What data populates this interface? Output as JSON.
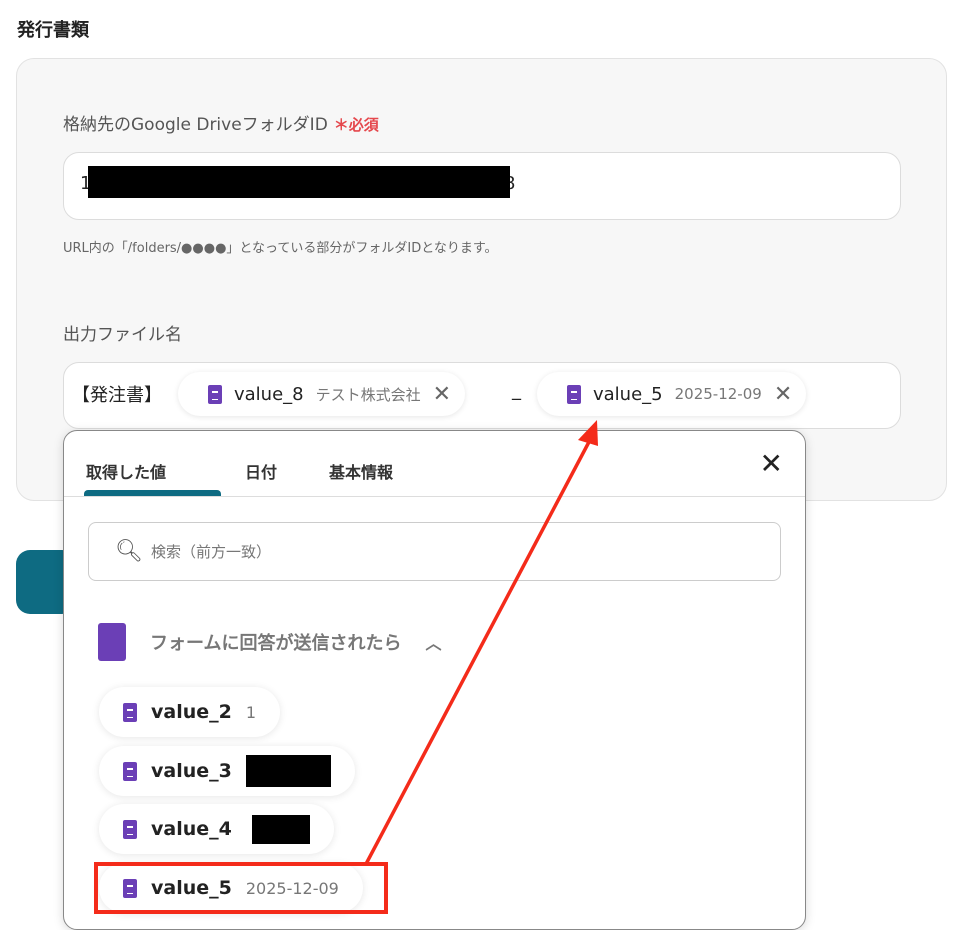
{
  "section_title": "発行書類",
  "folder_field": {
    "label": "格納先のGoogle DriveフォルダID",
    "required": "＊必須",
    "value_start": "1",
    "value_end": "8",
    "hint": "URL内の「/folders/●●●●」となっている部分がフォルダIDとなります。"
  },
  "filename_field": {
    "label": "出力ファイル名",
    "prefix": "【発注書】",
    "separator": "_",
    "chips": [
      {
        "name": "value_8",
        "value": "テスト株式会社"
      },
      {
        "name": "value_5",
        "value": "2025-12-09"
      }
    ]
  },
  "popup": {
    "tabs": [
      "取得した値",
      "日付",
      "基本情報"
    ],
    "search_placeholder": "検索（前方一致）",
    "group": "フォームに回答が送信されたら",
    "items": [
      {
        "name": "value_2",
        "value": "1"
      },
      {
        "name": "value_3",
        "value": ""
      },
      {
        "name": "value_4",
        "value": ""
      },
      {
        "name": "value_5",
        "value": "2025-12-09"
      }
    ]
  },
  "colors": {
    "accent": "#0e6b82",
    "annotation": "#f42b1a",
    "forms": "#6b3fb6"
  }
}
